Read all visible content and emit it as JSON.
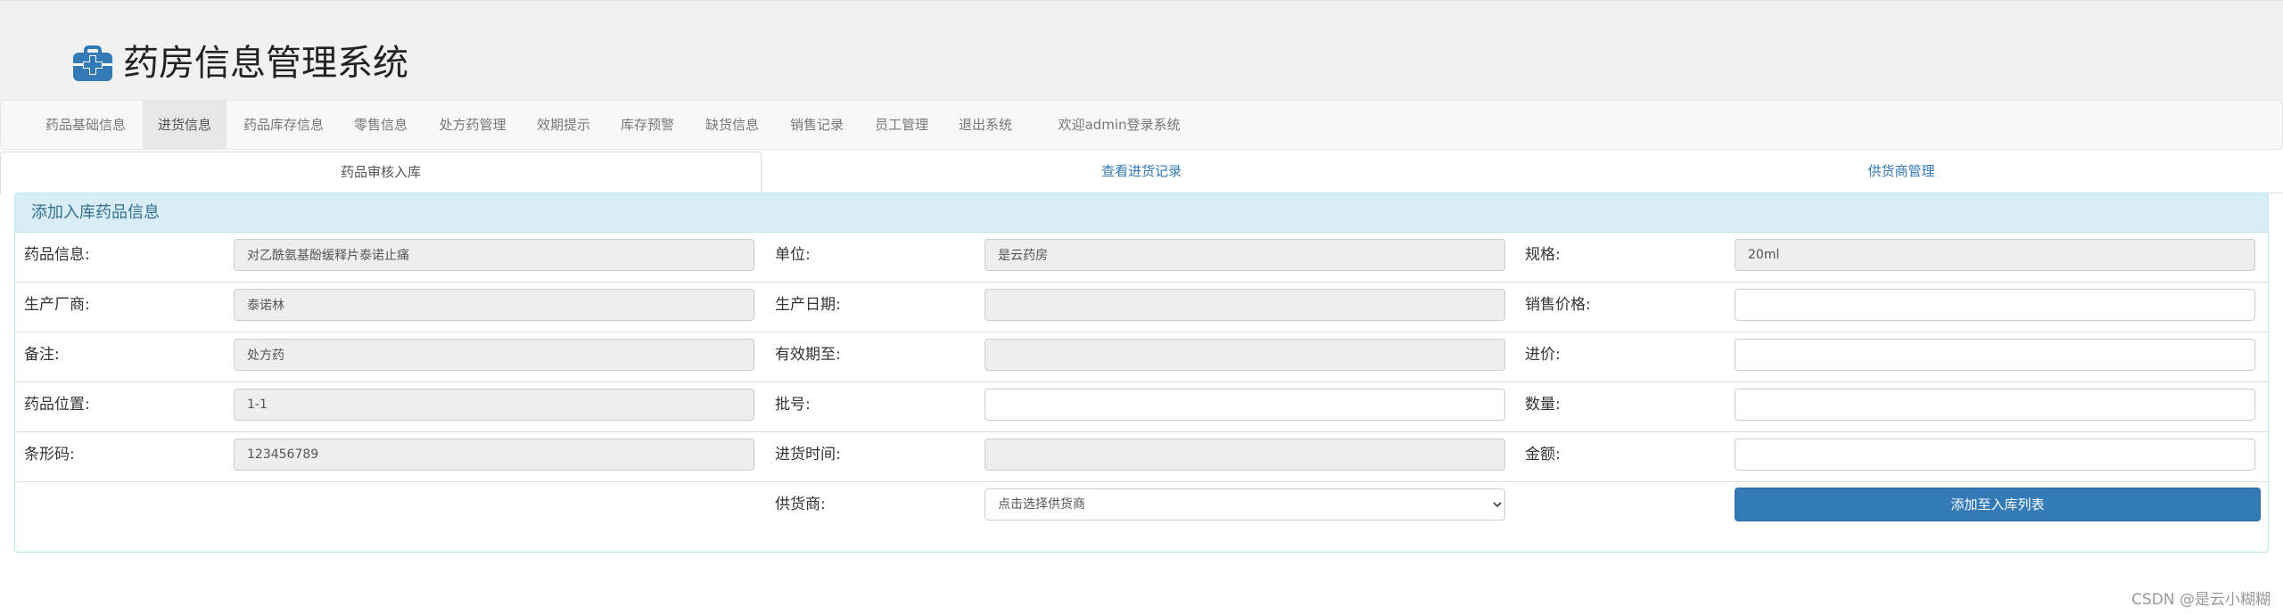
{
  "app": {
    "title": "药房信息管理系统",
    "logo_icon": "medkit-icon"
  },
  "nav": {
    "items": [
      {
        "label": "药品基础信息",
        "active": false
      },
      {
        "label": "进货信息",
        "active": true
      },
      {
        "label": "药品库存信息",
        "active": false
      },
      {
        "label": "零售信息",
        "active": false
      },
      {
        "label": "处方药管理",
        "active": false
      },
      {
        "label": "效期提示",
        "active": false
      },
      {
        "label": "库存预警",
        "active": false
      },
      {
        "label": "缺货信息",
        "active": false
      },
      {
        "label": "销售记录",
        "active": false
      },
      {
        "label": "员工管理",
        "active": false
      },
      {
        "label": "退出系统",
        "active": false
      },
      {
        "label": "欢迎admin登录系统",
        "active": false
      }
    ]
  },
  "tabs": [
    {
      "label": "药品审核入库",
      "active": true
    },
    {
      "label": "查看进货记录",
      "active": false
    },
    {
      "label": "供货商管理",
      "active": false
    }
  ],
  "panel": {
    "title": "添加入库药品信息",
    "fields": {
      "drug_info": {
        "label": "药品信息:",
        "value": "对乙酰氨基酚缓释片泰诺止痛"
      },
      "unit": {
        "label": "单位:",
        "value": "是云药房"
      },
      "spec": {
        "label": "规格:",
        "value": "20ml"
      },
      "manufacturer": {
        "label": "生产厂商:",
        "value": "泰诺林"
      },
      "production_date": {
        "label": "生产日期:",
        "value": ""
      },
      "sale_price": {
        "label": "销售价格:",
        "value": ""
      },
      "remark": {
        "label": "备注:",
        "value": "处方药"
      },
      "expiry": {
        "label": "有效期至:",
        "value": ""
      },
      "purchase_price": {
        "label": "进价:",
        "value": ""
      },
      "location": {
        "label": "药品位置:",
        "value": "1-1"
      },
      "batch": {
        "label": "批号:",
        "value": ""
      },
      "quantity": {
        "label": "数量:",
        "value": ""
      },
      "barcode": {
        "label": "条形码:",
        "value": "123456789"
      },
      "purchase_time": {
        "label": "进货时间:",
        "value": ""
      },
      "amount": {
        "label": "金额:",
        "value": ""
      },
      "supplier": {
        "label": "供货商:",
        "selected": "点击选择供货商"
      }
    },
    "submit_label": "添加至入库列表"
  },
  "watermark": "CSDN @是云小糊糊",
  "colors": {
    "primary": "#337ab7",
    "panel_heading_bg": "#d9edf7",
    "panel_heading_text": "#31708f",
    "readonly_bg": "#eeeeee"
  }
}
